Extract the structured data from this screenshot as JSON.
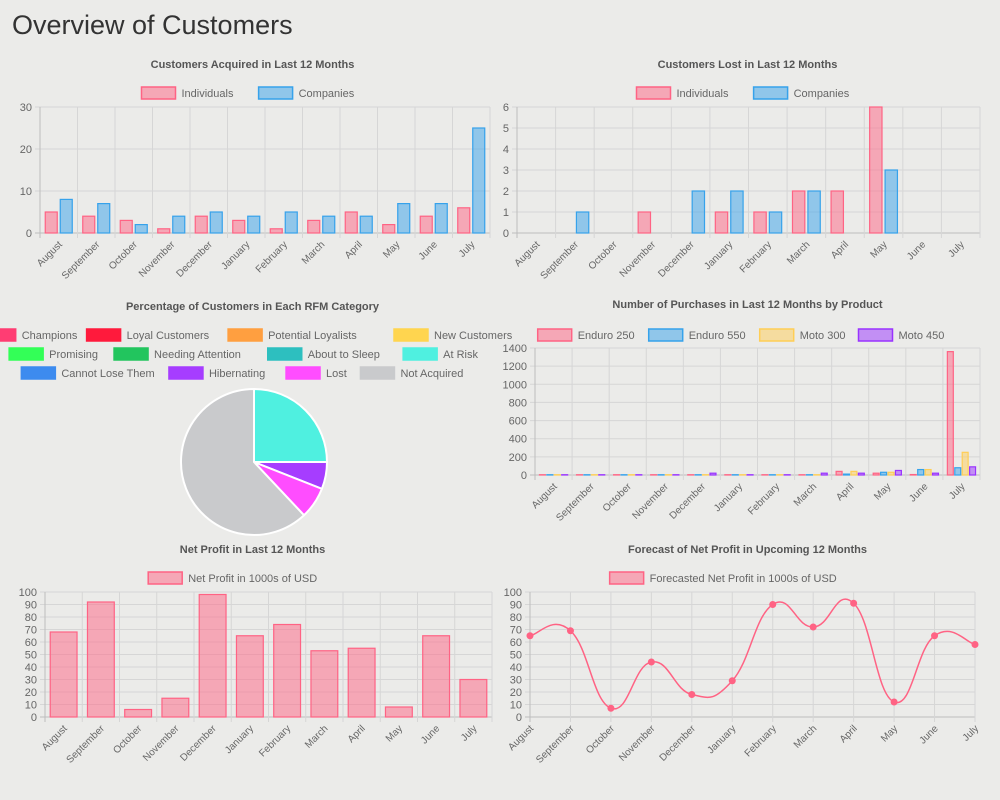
{
  "page": {
    "title": "Overview of Customers"
  },
  "colors": {
    "individuals_fill": "rgba(255, 99, 132, 0.5)",
    "individuals_stroke": "#ff6384",
    "companies_fill": "rgba(54, 162, 235, 0.5)",
    "companies_stroke": "#36a2eb",
    "moto300_fill": "rgba(255, 206, 86, 0.5)",
    "moto300_stroke": "#ffce56",
    "moto450_fill": "rgba(153, 51, 255, 0.5)",
    "moto450_stroke": "#9933ff",
    "grid": "#d6d6d6",
    "axis": "#bdbdbd",
    "tick": "#666",
    "title": "#555"
  },
  "chart_data": [
    {
      "id": "acquired",
      "type": "bar",
      "title": "Customers Acquired in Last 12 Months",
      "categories": [
        "August",
        "September",
        "October",
        "November",
        "December",
        "January",
        "February",
        "March",
        "April",
        "May",
        "June",
        "July"
      ],
      "series": [
        {
          "name": "Individuals",
          "values": [
            5,
            4,
            3,
            1,
            4,
            3,
            1,
            3,
            5,
            2,
            4,
            6
          ]
        },
        {
          "name": "Companies",
          "values": [
            8,
            7,
            2,
            4,
            5,
            4,
            5,
            4,
            4,
            7,
            7,
            25
          ]
        }
      ],
      "yticks": [
        0,
        10,
        20,
        30
      ],
      "ylim": [
        0,
        30
      ],
      "grid": true,
      "legend": "top"
    },
    {
      "id": "lost",
      "type": "bar",
      "title": "Customers Lost in Last 12 Months",
      "categories": [
        "August",
        "September",
        "October",
        "November",
        "December",
        "January",
        "February",
        "March",
        "April",
        "May",
        "June",
        "July"
      ],
      "series": [
        {
          "name": "Individuals",
          "values": [
            0,
            0,
            0,
            1,
            0,
            1,
            1,
            2,
            2,
            6,
            0,
            0
          ]
        },
        {
          "name": "Companies",
          "values": [
            0,
            1,
            0,
            0,
            2,
            2,
            1,
            2,
            0,
            3,
            0,
            0
          ]
        }
      ],
      "yticks": [
        0,
        1,
        2,
        3,
        4,
        5,
        6
      ],
      "ylim": [
        0,
        6
      ],
      "grid": true,
      "legend": "top"
    },
    {
      "id": "rfm",
      "type": "pie",
      "title": "Percentage of Customers in Each RFM Category",
      "labels": [
        "Champions",
        "Loyal Customers",
        "Potential Loyalists",
        "New Customers",
        "Promising",
        "Needing Attention",
        "About to Sleep",
        "At Risk",
        "Cannot Lose Them",
        "Hibernating",
        "Lost",
        "Not Acquired"
      ],
      "colors": [
        "#ff3d73",
        "#ff1a3c",
        "#ff9f40",
        "#ffd54f",
        "#33ff57",
        "#22c55e",
        "#2dbfbf",
        "#4ff0e0",
        "#3d8bef",
        "#a63dff",
        "#ff4dff",
        "#c9cacc"
      ],
      "values": [
        0,
        0,
        0,
        0,
        0,
        0,
        0,
        25,
        0,
        6,
        7,
        62
      ],
      "legend": "top"
    },
    {
      "id": "purchases",
      "type": "bar",
      "title": "Number of Purchases in Last 12 Months by Product",
      "categories": [
        "August",
        "September",
        "October",
        "November",
        "December",
        "January",
        "February",
        "March",
        "April",
        "May",
        "June",
        "July"
      ],
      "series": [
        {
          "name": "Enduro 250",
          "values": [
            3,
            3,
            3,
            3,
            3,
            3,
            3,
            3,
            40,
            20,
            5,
            1360
          ]
        },
        {
          "name": "Enduro 550",
          "values": [
            3,
            3,
            3,
            3,
            3,
            3,
            3,
            3,
            10,
            30,
            60,
            80
          ]
        },
        {
          "name": "Moto 300",
          "values": [
            3,
            3,
            3,
            3,
            3,
            3,
            3,
            3,
            40,
            30,
            60,
            250
          ]
        },
        {
          "name": "Moto 450",
          "values": [
            3,
            3,
            3,
            3,
            20,
            3,
            3,
            20,
            20,
            50,
            20,
            90
          ]
        }
      ],
      "yticks": [
        0,
        200,
        400,
        600,
        800,
        1000,
        1200,
        1400
      ],
      "ylim": [
        0,
        1400
      ],
      "grid": true,
      "legend": "top"
    },
    {
      "id": "profit",
      "type": "bar",
      "title": "Net Profit in Last 12 Months",
      "categories": [
        "August",
        "September",
        "October",
        "November",
        "December",
        "January",
        "February",
        "March",
        "April",
        "May",
        "June",
        "July"
      ],
      "series": [
        {
          "name": "Net Profit in 1000s of USD",
          "values": [
            68,
            92,
            6,
            15,
            98,
            65,
            74,
            53,
            55,
            8,
            65,
            30
          ]
        }
      ],
      "yticks": [
        0,
        10,
        20,
        30,
        40,
        50,
        60,
        70,
        80,
        90,
        100
      ],
      "ylim": [
        0,
        100
      ],
      "grid": true,
      "legend": "top"
    },
    {
      "id": "forecast",
      "type": "line",
      "title": "Forecast of Net Profit in Upcoming 12 Months",
      "categories": [
        "August",
        "September",
        "October",
        "November",
        "December",
        "January",
        "February",
        "March",
        "April",
        "May",
        "June",
        "July"
      ],
      "series": [
        {
          "name": "Forecasted Net Profit in 1000s of USD",
          "values": [
            65,
            69,
            7,
            44,
            18,
            29,
            90,
            72,
            91,
            12,
            65,
            58
          ]
        }
      ],
      "yticks": [
        0,
        10,
        20,
        30,
        40,
        50,
        60,
        70,
        80,
        90,
        100
      ],
      "ylim": [
        0,
        100
      ],
      "grid": true,
      "legend": "top"
    }
  ]
}
